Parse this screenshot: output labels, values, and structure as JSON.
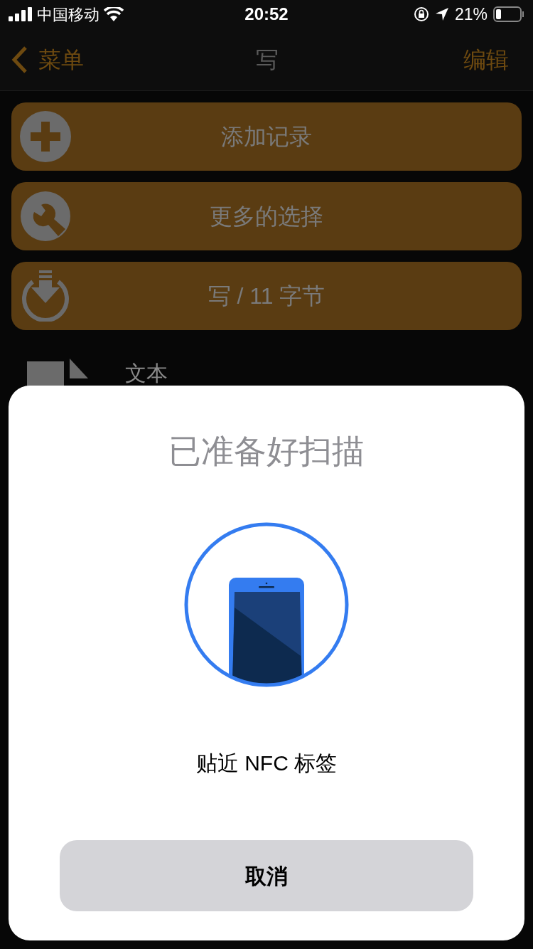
{
  "status_bar": {
    "carrier": "中国移动",
    "time": "20:52",
    "battery": "21%"
  },
  "nav_bar": {
    "back": "菜单",
    "title": "写",
    "action": "编辑"
  },
  "menu_buttons": [
    {
      "kind": "add",
      "label": "添加记录"
    },
    {
      "kind": "options",
      "label": "更多的选择"
    },
    {
      "kind": "write",
      "label": "写 / 11 字节"
    }
  ],
  "records": [
    {
      "label": "文本"
    }
  ],
  "scan_sheet": {
    "title": "已准备好扫描",
    "prompt": "贴近 NFC 标签",
    "cancel": "取消"
  }
}
